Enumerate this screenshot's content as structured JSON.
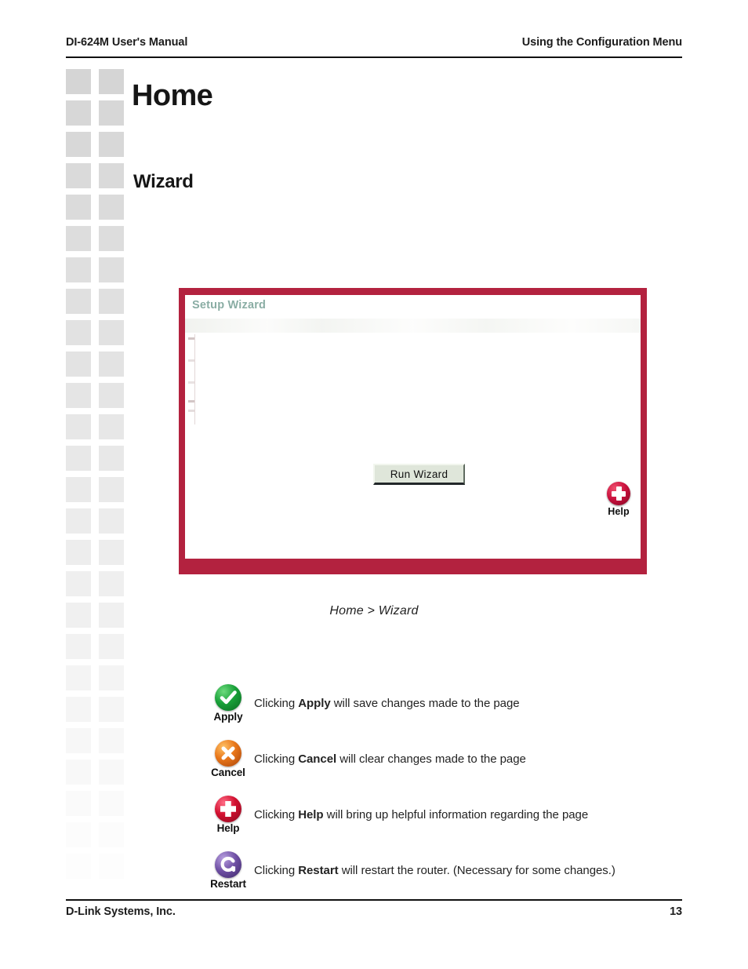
{
  "header": {
    "left": "DI-624M User's Manual",
    "right": "Using the Configuration Menu"
  },
  "titles": {
    "main": "Home",
    "section": "Wizard"
  },
  "screenshot": {
    "panel_title": "Setup Wizard",
    "run_button": "Run Wizard",
    "help_icon_label": "Help",
    "border_color": "#b3223f",
    "panel_title_color": "#8aada4",
    "button_face_color": "#dfe6da"
  },
  "caption": "Home > Wizard",
  "legend": {
    "items": [
      {
        "icon": "check-circle-icon",
        "icon_label": "Apply",
        "color": "#19a039",
        "text_before": "Clicking ",
        "text_bold": "Apply",
        "text_after": " will save changes made to the page"
      },
      {
        "icon": "x-circle-icon",
        "icon_label": "Cancel",
        "color": "#e8761a",
        "text_before": "Clicking ",
        "text_bold": "Cancel",
        "text_after": " will clear changes made to the page"
      },
      {
        "icon": "plus-circle-icon",
        "icon_label": "Help",
        "color": "#d21030",
        "text_before": "Clicking ",
        "text_bold": "Help",
        "text_after": " will bring up helpful information regarding the page"
      },
      {
        "icon": "refresh-circle-icon",
        "icon_label": "Restart",
        "color": "#6e4fa3",
        "text_before": "Clicking ",
        "text_bold": "Restart",
        "text_after": " will restart the router.  (Necessary for some changes.)"
      }
    ]
  },
  "footer": {
    "left": "D-Link Systems, Inc.",
    "page_number": "13"
  }
}
